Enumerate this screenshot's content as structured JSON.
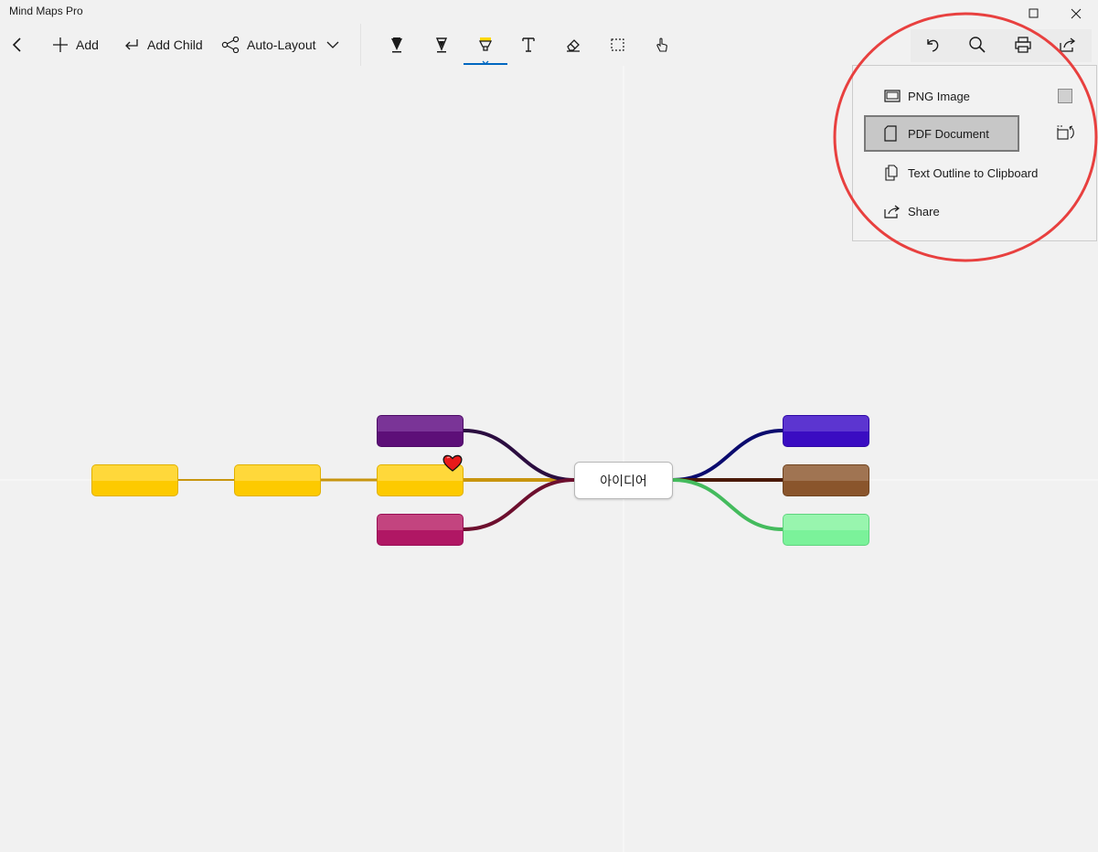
{
  "window": {
    "title": "Mind Maps Pro"
  },
  "toolbar": {
    "add_label": "Add",
    "add_child_label": "Add Child",
    "auto_layout_label": "Auto-Layout",
    "active_tool": "highlighter",
    "accent_color": "#0067c0"
  },
  "mindmap": {
    "center_label": "아이디어",
    "left_nodes_colors": [
      "#ffd32a",
      "#ffd32a",
      "#ffd32a",
      "#6e1e8a",
      "#c2206e"
    ],
    "right_nodes_colors": [
      "#4a1fc9",
      "#8e5a34",
      "#86f5a0"
    ],
    "connector_colors": {
      "yellow": "#c8950f",
      "purple": "#2b0d40",
      "maroon": "#6d0f2e",
      "navy": "#0b0b6e",
      "brown": "#4a1a08",
      "green": "#44bb5d"
    },
    "marker_icon": "heart-icon"
  },
  "export_menu": {
    "items": [
      {
        "label": "PNG Image",
        "icon": "image-icon"
      },
      {
        "label": "PDF Document",
        "icon": "document-icon",
        "selected": true
      },
      {
        "label": "Text Outline to Clipboard",
        "icon": "copy-icon"
      },
      {
        "label": "Share",
        "icon": "share-icon"
      }
    ]
  },
  "annotation": {
    "circle_color": "#e8403f"
  }
}
